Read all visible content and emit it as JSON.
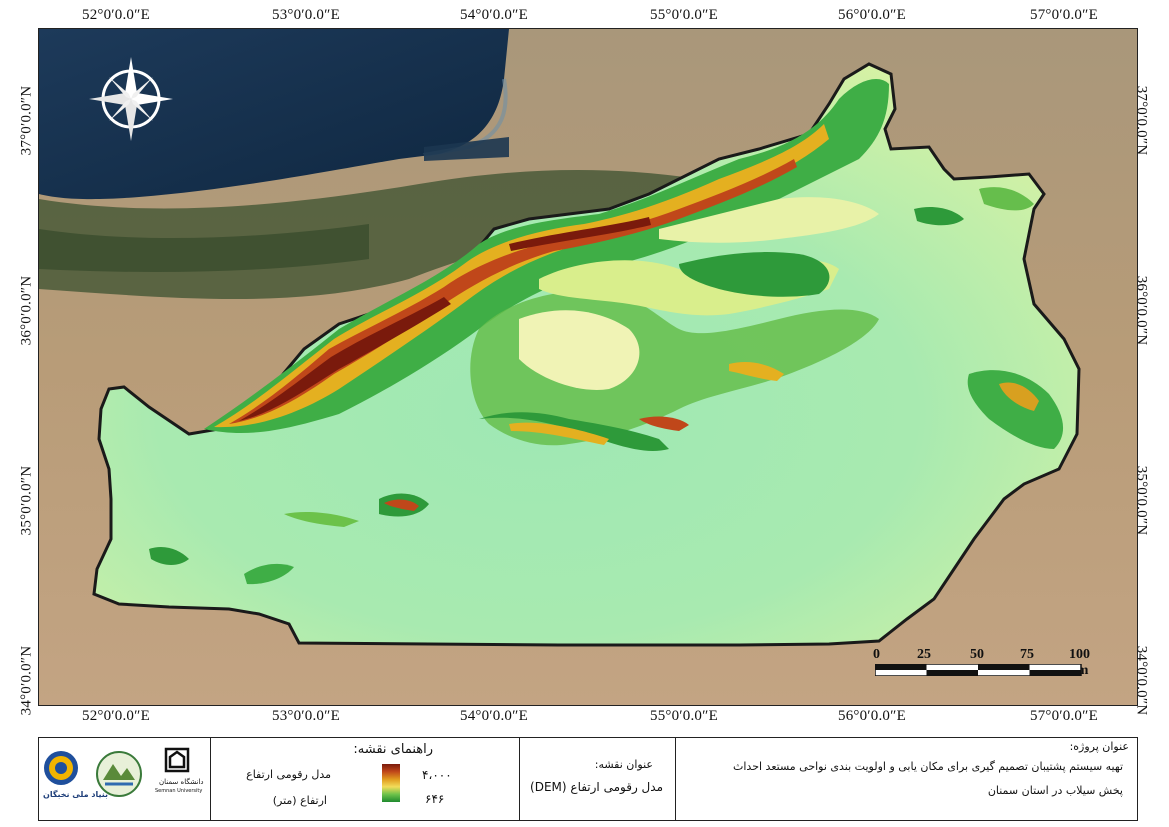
{
  "grid": {
    "top_ticks": [
      "52°0′0.0″E",
      "53°0′0.0″E",
      "54°0′0.0″E",
      "55°0′0.0″E",
      "56°0′0.0″E",
      "57°0′0.0″E"
    ],
    "bottom_ticks": [
      "52°0′0.0″E",
      "53°0′0.0″E",
      "54°0′0.0″E",
      "55°0′0.0″E",
      "56°0′0.0″E",
      "57°0′0.0″E"
    ],
    "left_ticks": [
      "37°0′0.0″N",
      "36°0′0.0″N",
      "35°0′0.0″N",
      "34°0′0.0″N"
    ],
    "right_ticks": [
      "37°0′0.0″N",
      "36°0′0.0″N",
      "35°0′0.0″N",
      "34°0′0.0″N"
    ]
  },
  "scale_bar": {
    "labels": [
      "0",
      "25",
      "50",
      "75",
      "100 km"
    ]
  },
  "legend": {
    "title": "راهنمای نقشه:",
    "item_title": "مدل رقومی ارتفاع",
    "item_subtitle": "ارتفاع (متر)",
    "max_value": "۴،۰۰۰",
    "min_value": "۶۴۶",
    "colors": [
      "#7a1a0c",
      "#c0471a",
      "#e09a1e",
      "#f2dc5a",
      "#6cc24a",
      "#1f8a2e"
    ]
  },
  "map_title": {
    "label": "عنوان نقشه:",
    "value": "مدل رقومی ارتفاع (DEM)"
  },
  "project_title": {
    "label": "عنوان پروژه:",
    "line1": "تهیه سیستم پشتیبان تصمیم گیری برای مکان یابی و اولویت بندی نواحی مستعد احداث",
    "line2": "پخش سیلاب در استان سمنان"
  },
  "logos": {
    "logo1_text": "دانشگاه سمنان",
    "logo1_sub": "Semnan University",
    "logo3_text": "بنیاد ملی نخبگان"
  }
}
